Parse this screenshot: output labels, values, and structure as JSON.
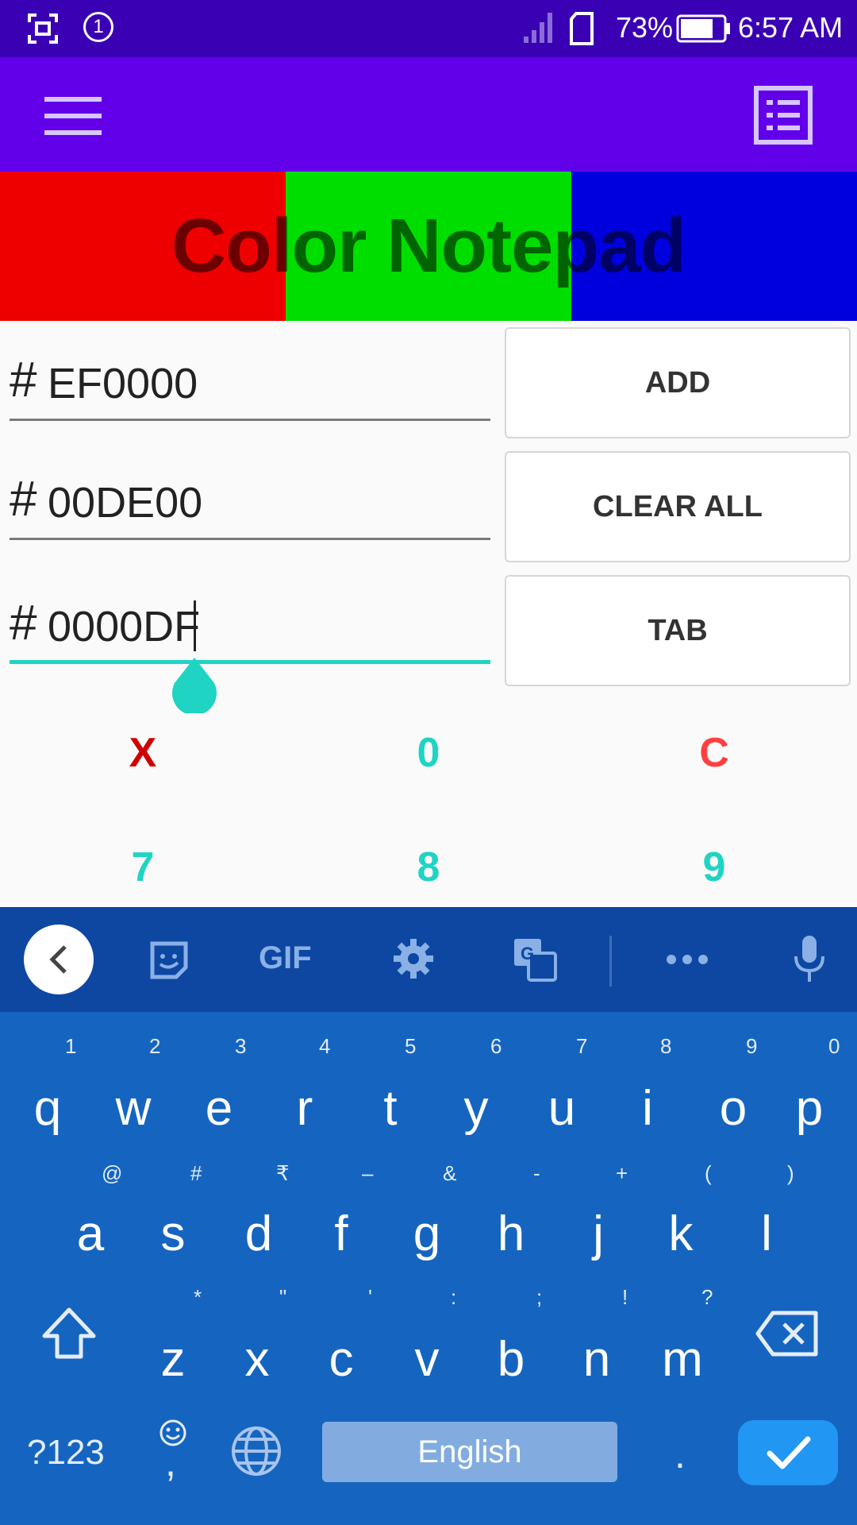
{
  "status_bar": {
    "badge": "1",
    "battery": "73%",
    "time": "6:57 AM"
  },
  "banner": {
    "title": "Color Notepad",
    "colors": [
      "#ef0000",
      "#00de00",
      "#0000df"
    ]
  },
  "fields": [
    {
      "prefix": "#",
      "value": "EF0000"
    },
    {
      "prefix": "#",
      "value": "00DE00"
    },
    {
      "prefix": "#",
      "value": "0000DF"
    }
  ],
  "buttons": {
    "add": "ADD",
    "clear_all": "CLEAR ALL",
    "tab": "TAB"
  },
  "keypad": {
    "row1": [
      "X",
      "0",
      "C"
    ],
    "row2": [
      "7",
      "8",
      "9"
    ]
  },
  "keyboard": {
    "toolbar": {
      "gif_label": "GIF"
    },
    "row1": [
      {
        "key": "q",
        "hint": "1"
      },
      {
        "key": "w",
        "hint": "2"
      },
      {
        "key": "e",
        "hint": "3"
      },
      {
        "key": "r",
        "hint": "4"
      },
      {
        "key": "t",
        "hint": "5"
      },
      {
        "key": "y",
        "hint": "6"
      },
      {
        "key": "u",
        "hint": "7"
      },
      {
        "key": "i",
        "hint": "8"
      },
      {
        "key": "o",
        "hint": "9"
      },
      {
        "key": "p",
        "hint": "0"
      }
    ],
    "row2": [
      {
        "key": "a",
        "hint": "@"
      },
      {
        "key": "s",
        "hint": "#"
      },
      {
        "key": "d",
        "hint": "₹"
      },
      {
        "key": "f",
        "hint": "–"
      },
      {
        "key": "g",
        "hint": "&"
      },
      {
        "key": "h",
        "hint": "-"
      },
      {
        "key": "j",
        "hint": "+"
      },
      {
        "key": "k",
        "hint": "("
      },
      {
        "key": "l",
        "hint": ")"
      }
    ],
    "row3": [
      {
        "key": "z",
        "hint": "*"
      },
      {
        "key": "x",
        "hint": "\""
      },
      {
        "key": "c",
        "hint": "'"
      },
      {
        "key": "v",
        "hint": ":"
      },
      {
        "key": "b",
        "hint": ";"
      },
      {
        "key": "n",
        "hint": "!"
      },
      {
        "key": "m",
        "hint": "?"
      }
    ],
    "symbols_label": "?123",
    "comma": ",",
    "space_label": "English",
    "period": "."
  },
  "colors": {
    "status_bar": "#3a00b4",
    "app_bar": "#6200ea",
    "accent": "#1fd4c2",
    "keyboard": "#1565c0",
    "keyboard_toolbar": "#0d47a1",
    "x_key": "#d00000",
    "c_key": "#ff4040"
  }
}
